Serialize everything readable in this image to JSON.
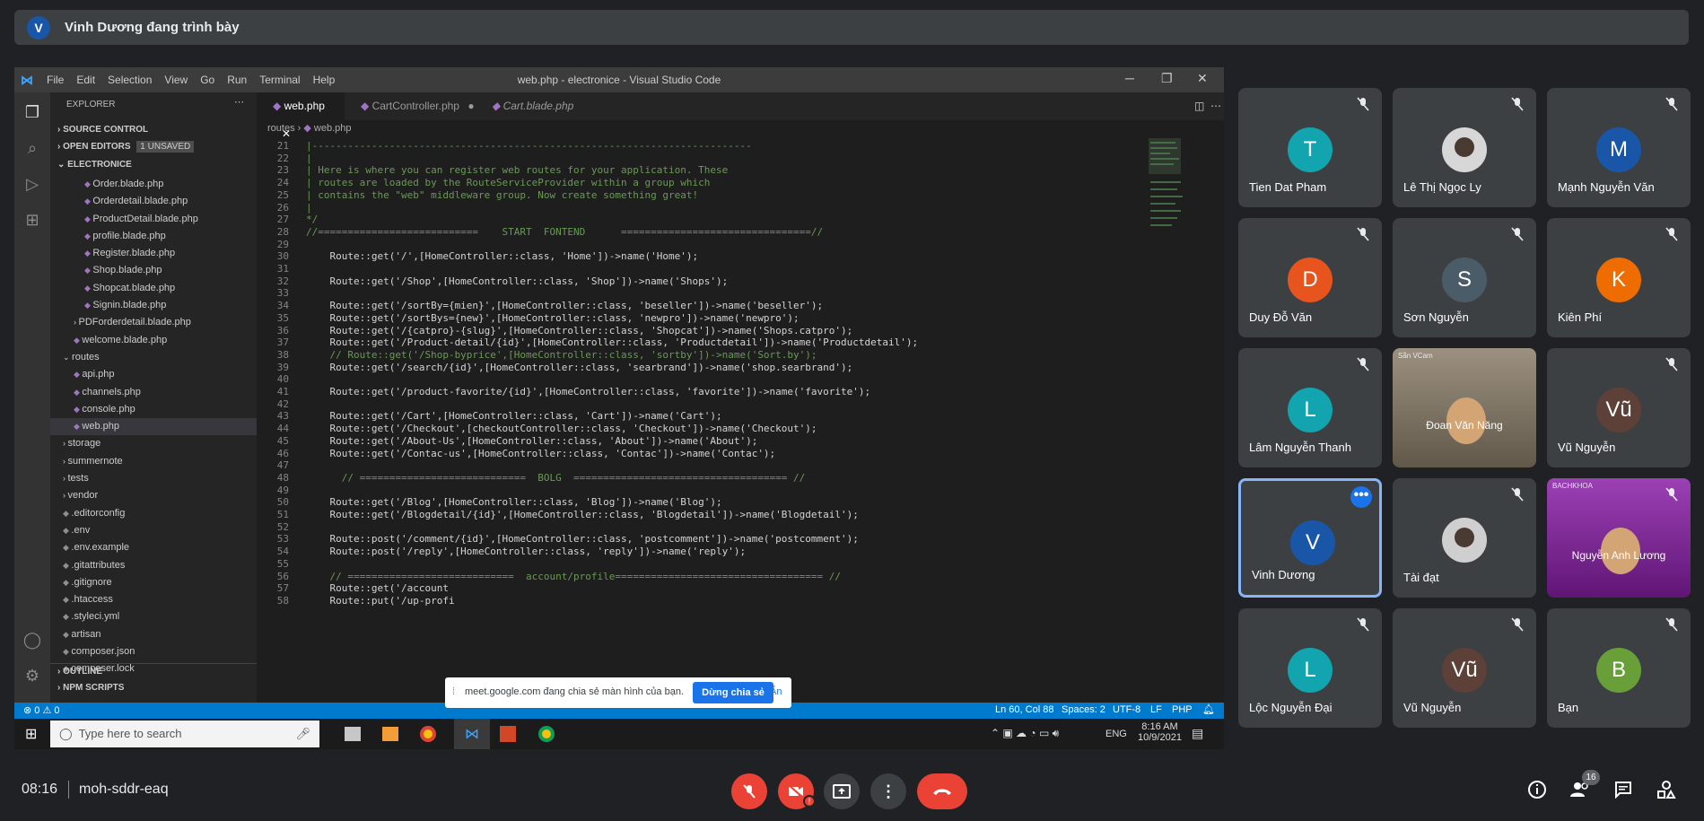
{
  "presenter": {
    "avatar": "V",
    "text": "Vinh Dương đang trình bày"
  },
  "vscode": {
    "title": "web.php - electronice - Visual Studio Code",
    "menu": [
      "File",
      "Edit",
      "Selection",
      "View",
      "Go",
      "Run",
      "Terminal",
      "Help"
    ],
    "explorer_label": "EXPLORER",
    "source_control": "SOURCE CONTROL",
    "open_editors": "OPEN EDITORS",
    "unsaved_badge": "1 UNSAVED",
    "project": "ELECTRONICE",
    "files": [
      {
        "n": "Order.blade.php",
        "d": 2
      },
      {
        "n": "Orderdetail.blade.php",
        "d": 2
      },
      {
        "n": "ProductDetail.blade.php",
        "d": 2
      },
      {
        "n": "profile.blade.php",
        "d": 2
      },
      {
        "n": "Register.blade.php",
        "d": 2
      },
      {
        "n": "Shop.blade.php",
        "d": 2
      },
      {
        "n": "Shopcat.blade.php",
        "d": 2
      },
      {
        "n": "Signin.blade.php",
        "d": 2
      },
      {
        "n": "PDForderdetail.blade.php",
        "d": 1,
        "folder": true
      },
      {
        "n": "welcome.blade.php",
        "d": 1
      },
      {
        "n": "routes",
        "d": 0,
        "folder": true,
        "open": true
      },
      {
        "n": "api.php",
        "d": 1
      },
      {
        "n": "channels.php",
        "d": 1
      },
      {
        "n": "console.php",
        "d": 1
      },
      {
        "n": "web.php",
        "d": 1,
        "sel": true
      },
      {
        "n": "storage",
        "d": 0,
        "folder": true
      },
      {
        "n": "summernote",
        "d": 0,
        "folder": true
      },
      {
        "n": "tests",
        "d": 0,
        "folder": true
      },
      {
        "n": "vendor",
        "d": 0,
        "folder": true
      },
      {
        "n": ".editorconfig",
        "d": 0
      },
      {
        "n": ".env",
        "d": 0
      },
      {
        "n": ".env.example",
        "d": 0
      },
      {
        "n": ".gitattributes",
        "d": 0
      },
      {
        "n": ".gitignore",
        "d": 0
      },
      {
        "n": ".htaccess",
        "d": 0
      },
      {
        "n": ".styleci.yml",
        "d": 0
      },
      {
        "n": "artisan",
        "d": 0
      },
      {
        "n": "composer.json",
        "d": 0
      },
      {
        "n": "composer.lock",
        "d": 0
      }
    ],
    "outline": "OUTLINE",
    "npm": "NPM SCRIPTS",
    "tabs": [
      "web.php",
      "CartController.php",
      "Cart.blade.php"
    ],
    "breadcrumb": [
      "routes",
      "web.php"
    ],
    "lines": [
      {
        "n": "21",
        "t": "|--------------------------------------------------------------------------",
        "c": "cm"
      },
      {
        "n": "22",
        "t": "|",
        "c": "cm"
      },
      {
        "n": "23",
        "t": "| Here is where you can register web routes for your application. These",
        "c": "cm"
      },
      {
        "n": "24",
        "t": "| routes are loaded by the RouteServiceProvider within a group which",
        "c": "cm"
      },
      {
        "n": "25",
        "t": "| contains the \"web\" middleware group. Now create something great!",
        "c": "cm"
      },
      {
        "n": "26",
        "t": "|",
        "c": "cm"
      },
      {
        "n": "27",
        "t": "*/",
        "c": "cm"
      },
      {
        "n": "28",
        "t": "//===========================    START  FONTEND      ================================//",
        "c": "cm"
      },
      {
        "n": "29",
        "t": "",
        "c": ""
      },
      {
        "n": "30",
        "t": "    Route::get('/',[HomeController::class, 'Home'])->name('Home');",
        "c": ""
      },
      {
        "n": "31",
        "t": "",
        "c": ""
      },
      {
        "n": "32",
        "t": "    Route::get('/Shop',[HomeController::class, 'Shop'])->name('Shops');",
        "c": ""
      },
      {
        "n": "33",
        "t": "",
        "c": ""
      },
      {
        "n": "34",
        "t": "    Route::get('/sortBy={mien}',[HomeController::class, 'beseller'])->name('beseller');",
        "c": ""
      },
      {
        "n": "35",
        "t": "    Route::get('/sortBys={new}',[HomeController::class, 'newpro'])->name('newpro');",
        "c": ""
      },
      {
        "n": "36",
        "t": "    Route::get('/{catpro}-{slug}',[HomeController::class, 'Shopcat'])->name('Shops.catpro');",
        "c": ""
      },
      {
        "n": "37",
        "t": "    Route::get('/Product-detail/{id}',[HomeController::class, 'Productdetail'])->name('Productdetail');",
        "c": ""
      },
      {
        "n": "38",
        "t": "    // Route::get('/Shop-byprice',[HomeController::class, 'sortby'])->name('Sort.by');",
        "c": "cm"
      },
      {
        "n": "39",
        "t": "    Route::get('/search/{id}',[HomeController::class, 'searbrand'])->name('shop.searbrand');",
        "c": ""
      },
      {
        "n": "40",
        "t": "",
        "c": ""
      },
      {
        "n": "41",
        "t": "    Route::get('/product-favorite/{id}',[HomeController::class, 'favorite'])->name('favorite');",
        "c": ""
      },
      {
        "n": "42",
        "t": "",
        "c": ""
      },
      {
        "n": "43",
        "t": "    Route::get('/Cart',[HomeController::class, 'Cart'])->name('Cart');",
        "c": ""
      },
      {
        "n": "44",
        "t": "    Route::get('/Checkout',[checkoutController::class, 'Checkout'])->name('Checkout');",
        "c": ""
      },
      {
        "n": "45",
        "t": "    Route::get('/About-Us',[HomeController::class, 'About'])->name('About');",
        "c": ""
      },
      {
        "n": "46",
        "t": "    Route::get('/Contac-us',[HomeController::class, 'Contac'])->name('Contac');",
        "c": ""
      },
      {
        "n": "47",
        "t": "",
        "c": ""
      },
      {
        "n": "48",
        "t": "      // ============================  BOLG  ==================================== //",
        "c": "cm"
      },
      {
        "n": "49",
        "t": "",
        "c": ""
      },
      {
        "n": "50",
        "t": "    Route::get('/Blog',[HomeController::class, 'Blog'])->name('Blog');",
        "c": ""
      },
      {
        "n": "51",
        "t": "    Route::get('/Blogdetail/{id}',[HomeController::class, 'Blogdetail'])->name('Blogdetail');",
        "c": ""
      },
      {
        "n": "52",
        "t": "",
        "c": ""
      },
      {
        "n": "53",
        "t": "    Route::post('/comment/{id}',[HomeController::class, 'postcomment'])->name('postcomment');",
        "c": ""
      },
      {
        "n": "54",
        "t": "    Route::post('/reply',[HomeController::class, 'reply'])->name('reply');",
        "c": ""
      },
      {
        "n": "55",
        "t": "",
        "c": ""
      },
      {
        "n": "56",
        "t": "    // ============================  account/profile=================================== //",
        "c": "cm"
      },
      {
        "n": "57",
        "t": "    Route::get('/account",
        "c": ""
      },
      {
        "n": "58",
        "t": "    Route::put('/up-profi",
        "c": ""
      }
    ],
    "status": {
      "errors": "⊗ 0 ⚠ 0",
      "pos": "Ln 60, Col 88",
      "spaces": "Spaces: 2",
      "enc": "UTF-8",
      "eol": "LF",
      "lang": "PHP"
    },
    "taskbar": {
      "search": "Type here to search",
      "lang": "ENG",
      "time": "8:16 AM",
      "date": "10/9/2021"
    }
  },
  "share_banner": {
    "text": "meet.google.com đang chia sẻ màn hình của bạn.",
    "stop": "Dừng chia sẻ",
    "hide": "Ẩn"
  },
  "participants": [
    {
      "name": "Tien Dat Pham",
      "letter": "T",
      "color": "#12a4af",
      "muted": true
    },
    {
      "name": "Lê Thị Ngọc Ly",
      "letter": "",
      "color": "#d7d7d7",
      "photo": true,
      "muted": true
    },
    {
      "name": "Mạnh Nguyễn Văn",
      "letter": "M",
      "color": "#1a56a8",
      "muted": true
    },
    {
      "name": "Duy Đỗ Văn",
      "letter": "D",
      "color": "#e8541e",
      "muted": true
    },
    {
      "name": "Sơn Nguyễn",
      "letter": "S",
      "color": "#4a5c68",
      "muted": true
    },
    {
      "name": "Kiên Phí",
      "letter": "K",
      "color": "#ef6c00",
      "muted": true
    },
    {
      "name": "Lâm Nguyễn Thanh",
      "letter": "L",
      "color": "#12a4af",
      "muted": true
    },
    {
      "name": "Đoan Văn Năng",
      "letter": "",
      "color": "#8b7e6a",
      "video": true,
      "muted": false,
      "video_label": "Sẵn VCam"
    },
    {
      "name": "Vũ Nguyễn",
      "letter": "Vũ",
      "color": "#5d4037",
      "muted": true
    },
    {
      "name": "Vinh Dương",
      "letter": "V",
      "color": "#1a56a8",
      "muted": false,
      "active": true
    },
    {
      "name": "Tài đạt",
      "letter": "",
      "color": "#cfcfcf",
      "photo": true,
      "muted": true
    },
    {
      "name": "Nguyễn Anh Lương",
      "letter": "",
      "color": "#8a1fa8",
      "video": true,
      "muted": true,
      "video_label": "BACHKHOA"
    },
    {
      "name": "Lộc Nguyễn Đại",
      "letter": "L",
      "color": "#12a4af",
      "muted": true
    },
    {
      "name": "Vũ Nguyễn",
      "letter": "Vũ",
      "color": "#5d4037",
      "muted": true
    },
    {
      "name": "Bạn",
      "letter": "B",
      "color": "#689f38",
      "muted": true
    }
  ],
  "meeting": {
    "time": "08:16",
    "code": "moh-sddr-eaq",
    "people_count": "16"
  },
  "colors": {
    "end_call": "#ea4335",
    "active_border": "#8ab4f8",
    "vs_blue": "#007acc"
  }
}
